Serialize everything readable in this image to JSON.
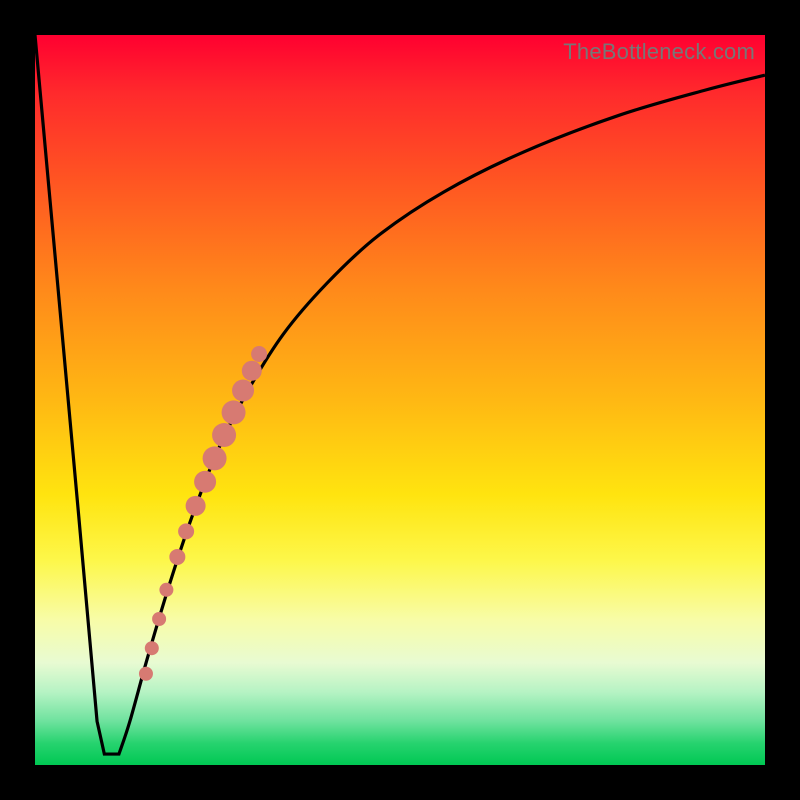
{
  "watermark": "TheBottleneck.com",
  "colors": {
    "curve_stroke": "#000000",
    "dot_fill": "#d77a72",
    "flat_bottom_y": 0.985
  },
  "chart_data": {
    "type": "line",
    "title": "",
    "xlabel": "",
    "ylabel": "",
    "xlim": [
      0,
      1
    ],
    "ylim": [
      0,
      1
    ],
    "series": [
      {
        "name": "bottleneck-curve",
        "comment": "Normalized (0..1) coordinates; y=0 is top of plot, y=1 is bottom. Left falling segment, short flat bottom, then rising asymptotic segment.",
        "x": [
          0.0,
          0.03,
          0.06,
          0.085,
          0.095,
          0.105,
          0.115,
          0.13,
          0.155,
          0.185,
          0.215,
          0.25,
          0.29,
          0.34,
          0.4,
          0.47,
          0.56,
          0.67,
          0.8,
          0.92,
          1.0
        ],
        "y": [
          0.0,
          0.33,
          0.66,
          0.94,
          0.985,
          0.985,
          0.985,
          0.94,
          0.85,
          0.75,
          0.66,
          0.57,
          0.49,
          0.41,
          0.34,
          0.275,
          0.215,
          0.16,
          0.11,
          0.075,
          0.055
        ]
      }
    ],
    "markers": {
      "comment": "Salmon dots along the rising branch, forming a dense diagonal cluster plus a few sparse ones below.",
      "points": [
        {
          "x": 0.195,
          "y": 0.715,
          "r": 8
        },
        {
          "x": 0.207,
          "y": 0.68,
          "r": 8
        },
        {
          "x": 0.22,
          "y": 0.645,
          "r": 10
        },
        {
          "x": 0.233,
          "y": 0.612,
          "r": 11
        },
        {
          "x": 0.246,
          "y": 0.58,
          "r": 12
        },
        {
          "x": 0.259,
          "y": 0.548,
          "r": 12
        },
        {
          "x": 0.272,
          "y": 0.517,
          "r": 12
        },
        {
          "x": 0.285,
          "y": 0.487,
          "r": 11
        },
        {
          "x": 0.297,
          "y": 0.46,
          "r": 10
        },
        {
          "x": 0.307,
          "y": 0.437,
          "r": 8
        },
        {
          "x": 0.18,
          "y": 0.76,
          "r": 7
        },
        {
          "x": 0.17,
          "y": 0.8,
          "r": 7
        },
        {
          "x": 0.16,
          "y": 0.84,
          "r": 7
        },
        {
          "x": 0.152,
          "y": 0.875,
          "r": 7
        }
      ]
    }
  }
}
